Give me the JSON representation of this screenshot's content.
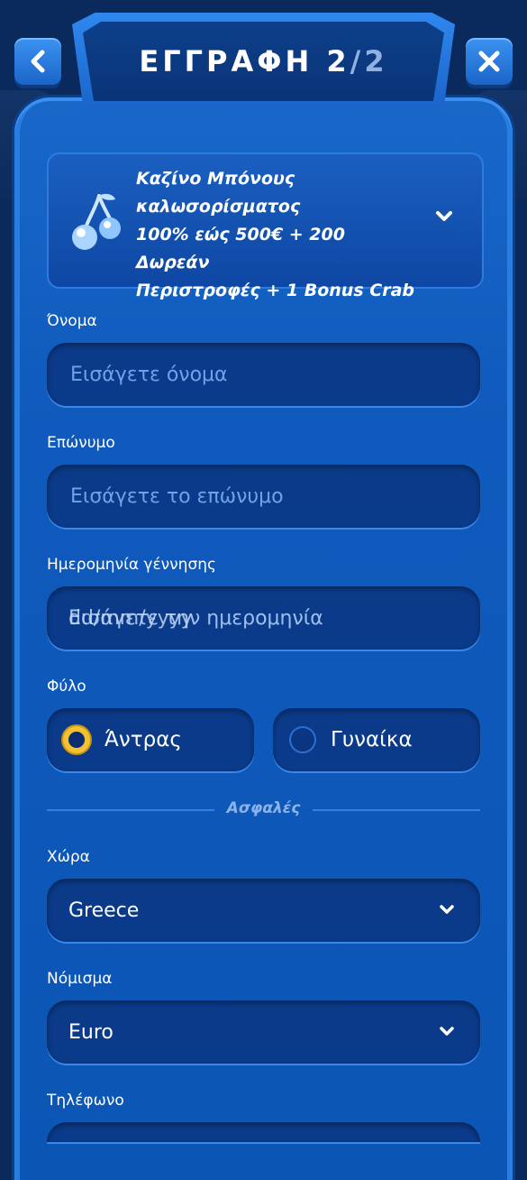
{
  "header": {
    "title": "ΕΓΓΡΑΦΗ 2",
    "title_slash": "/2",
    "back_icon": "chevron-left-icon",
    "close_icon": "close-icon"
  },
  "bonus": {
    "line1": "Καζίνο Μπόνους",
    "line2": "καλωσορίσματος",
    "line3": "100% εώς 500€ + 200 Δωρεάν",
    "line4": "Περιστροφές + 1 Bonus Crab",
    "icon": "cherries-icon"
  },
  "form": {
    "first_name": {
      "label": "Όνομα",
      "placeholder": "Εισάγετε όνομα"
    },
    "last_name": {
      "label": "Επώνυμο",
      "placeholder": "Εισάγετε το επώνυμο"
    },
    "birthdate": {
      "label": "Ημερομηνία γέννησης",
      "placeholder": "Εισάγετε την ημερομηνία",
      "format_hint": "dd/mm/yyyy"
    },
    "gender": {
      "label": "Φύλο",
      "options": [
        {
          "label": "Άντρας",
          "selected": true
        },
        {
          "label": "Γυναίκα",
          "selected": false
        }
      ]
    },
    "divider_text": "Ασφαλές",
    "country": {
      "label": "Χώρα",
      "value": "Greece"
    },
    "currency": {
      "label": "Νόμισμα",
      "value": "Euro"
    },
    "phone": {
      "label": "Τηλέφωνο"
    }
  },
  "colors": {
    "panel": "#0f5abc",
    "field": "#0a3a8a",
    "accent_gold": "#f2c230",
    "placeholder": "#6fa3e8"
  }
}
